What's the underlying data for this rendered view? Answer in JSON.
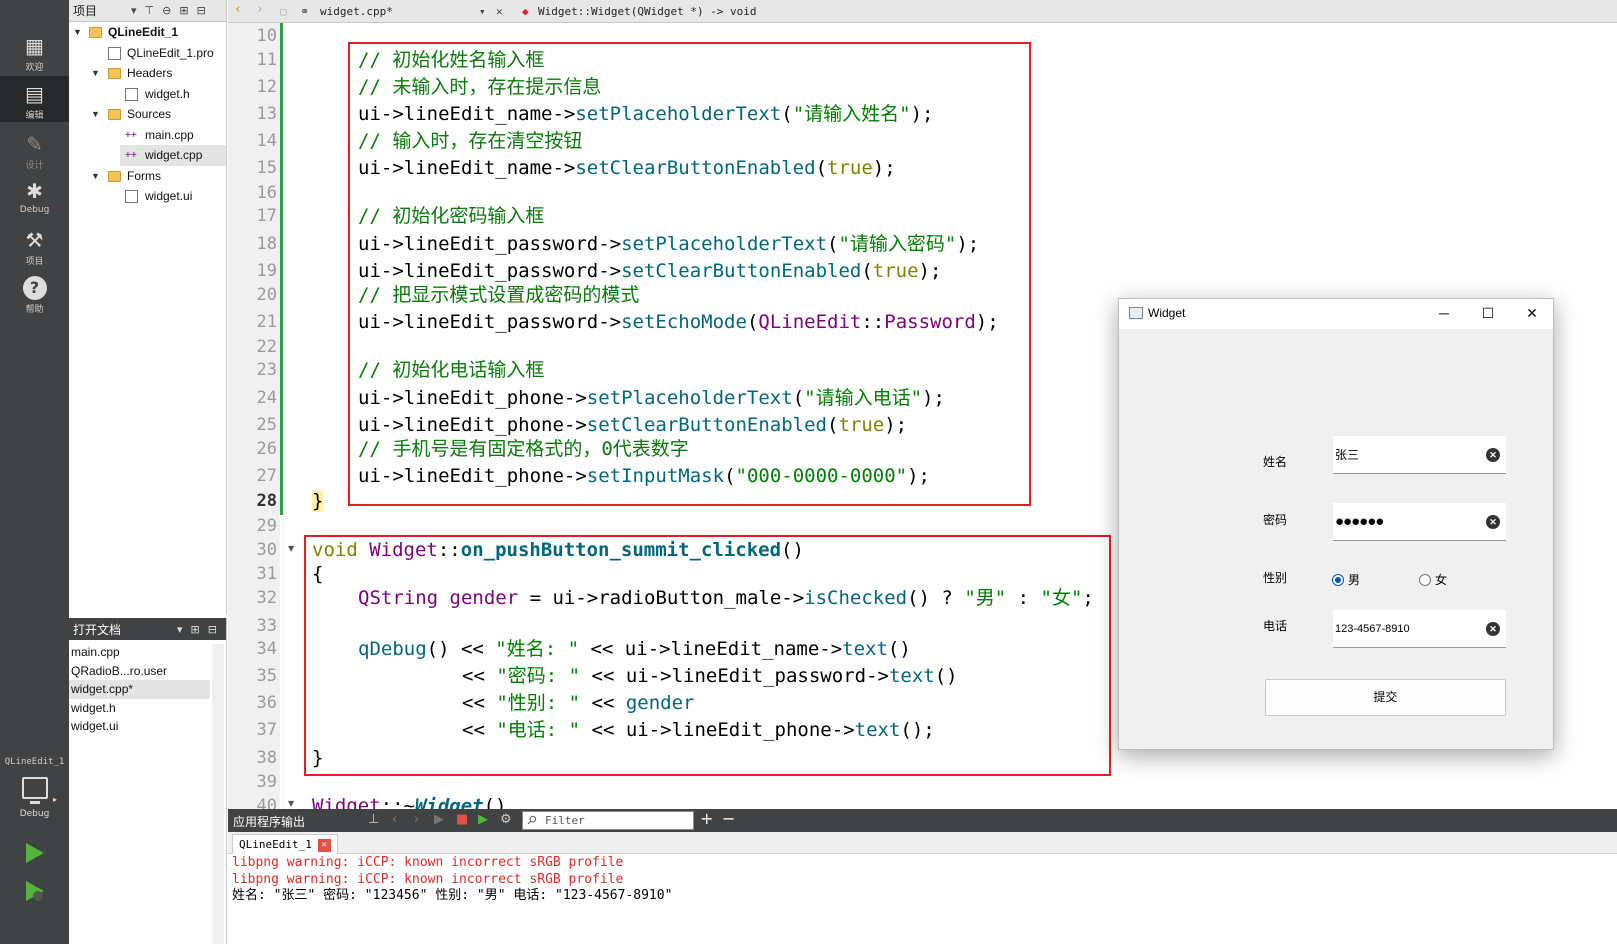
{
  "modebar": {
    "modes": [
      {
        "label": "欢迎",
        "icon": "grid-icon"
      },
      {
        "label": "编辑",
        "icon": "edit-icon"
      },
      {
        "label": "设计",
        "icon": "pen-icon"
      },
      {
        "label": "Debug",
        "icon": "bug-icon"
      },
      {
        "label": "项目",
        "icon": "wrench-icon"
      },
      {
        "label": "帮助",
        "icon": "help-icon"
      }
    ],
    "kit_project": "QLineEdit_1",
    "kit_mode": "Debug"
  },
  "project_pane": {
    "title": "项目",
    "tree": [
      {
        "label": "QLineEdit_1",
        "level": 0,
        "kind": "project"
      },
      {
        "label": "QLineEdit_1.pro",
        "level": 1,
        "kind": "file"
      },
      {
        "label": "Headers",
        "level": 1,
        "kind": "folder"
      },
      {
        "label": "widget.h",
        "level": 2,
        "kind": "file"
      },
      {
        "label": "Sources",
        "level": 1,
        "kind": "folder"
      },
      {
        "label": "main.cpp",
        "level": 2,
        "kind": "cpp"
      },
      {
        "label": "widget.cpp",
        "level": 2,
        "kind": "cpp"
      },
      {
        "label": "Forms",
        "level": 1,
        "kind": "folder"
      },
      {
        "label": "widget.ui",
        "level": 2,
        "kind": "file"
      }
    ]
  },
  "open_docs": {
    "title": "打开文档",
    "items": [
      "main.cpp",
      "QRadioB...ro.user",
      "widget.cpp*",
      "widget.h",
      "widget.ui"
    ]
  },
  "editor_toolbar": {
    "file": "widget.cpp*",
    "symbol": "Widget::Widget(QWidget *) -> void"
  },
  "editor": {
    "line_numbers": [
      "10",
      "11",
      "12",
      "13",
      "14",
      "15",
      "16",
      "17",
      "18",
      "19",
      "20",
      "21",
      "22",
      "23",
      "24",
      "25",
      "26",
      "27",
      "28",
      "29",
      "30",
      "31",
      "32",
      "33",
      "34",
      "35",
      "36",
      "37",
      "38",
      "39",
      "40"
    ],
    "current_line": "28"
  },
  "output": {
    "title": "应用程序输出",
    "filter_placeholder": "Filter",
    "tab": "QLineEdit_1",
    "lines": [
      "libpng warning: iCCP: known incorrect sRGB profile",
      "libpng warning: iCCP: known incorrect sRGB profile",
      "姓名: \"张三\" 密码: \"123456\" 性别: \"男\" 电话: \"123-4567-8910\""
    ]
  },
  "widget_window": {
    "title": "Widget",
    "name_label": "姓名",
    "name_value": "张三",
    "password_label": "密码",
    "password_value": "●●●●●●",
    "gender_label": "性别",
    "gender_male": "男",
    "gender_female": "女",
    "gender_selected": "男",
    "phone_label": "电话",
    "phone_value": "123-4567-8910",
    "submit_label": "提交"
  },
  "colors": {
    "annotation_box": "#e41e26",
    "comment": "#0a7a0a",
    "keyword": "#808000",
    "function": "#00677c",
    "type": "#800080",
    "string": "#008000"
  }
}
